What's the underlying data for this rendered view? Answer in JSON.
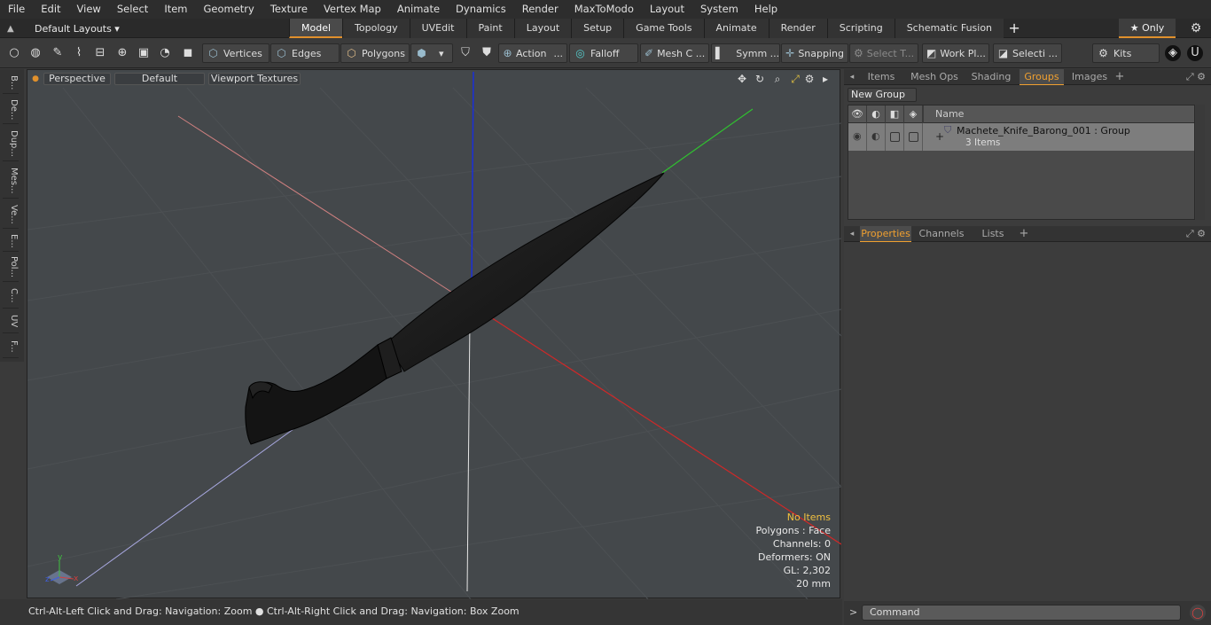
{
  "menu": [
    "File",
    "Edit",
    "View",
    "Select",
    "Item",
    "Geometry",
    "Texture",
    "Vertex Map",
    "Animate",
    "Dynamics",
    "Render",
    "MaxToModo",
    "Layout",
    "System",
    "Help"
  ],
  "tabbar": {
    "layout_label": "Default Layouts ▾",
    "tabs": [
      "Model",
      "Topology",
      "UVEdit",
      "Paint",
      "Layout",
      "Setup",
      "Game Tools",
      "Animate",
      "Render",
      "Scripting",
      "Schematic Fusion"
    ],
    "active_tab": "Model",
    "plus": "+",
    "only_label": "★  Only"
  },
  "toolbar": {
    "vertices": "Vertices",
    "edges": "Edges",
    "polygons": "Polygons",
    "action": "Action",
    "falloff": "Falloff",
    "mesh": "Mesh C ...",
    "symm": "Symm ...",
    "snapping": "Snapping",
    "select_t": "Select T...",
    "workplane": "Work Pl...",
    "selecti": "Selecti ...",
    "kits": "Kits"
  },
  "left_tabs": [
    "B...",
    "De...",
    "Dup...",
    "Mes...",
    "Ve...",
    "E...",
    "Pol...",
    "C...",
    "UV",
    "F..."
  ],
  "viewport": {
    "view_mode": "Perspective",
    "shading": "Default",
    "textures": "Viewport Textures",
    "info": {
      "items": "No Items",
      "polygons": "Polygons : Face",
      "channels": "Channels: 0",
      "deformers": "Deformers: ON",
      "gl": "GL: 2,302",
      "scale": "20 mm"
    },
    "colors": {
      "x_axis": "#c83030",
      "y_axis": "#30b030",
      "z_axis": "#2030c0",
      "model": "#1a1a1a"
    }
  },
  "status": "Ctrl-Alt-Left Click and Drag: Navigation: Zoom ● Ctrl-Alt-Right Click and Drag: Navigation: Box Zoom",
  "top_panel": {
    "tabs": [
      "Items",
      "Mesh Ops",
      "Shading",
      "Groups",
      "Images"
    ],
    "active": "Groups",
    "new_group": "New Group",
    "name_header": "Name",
    "row": {
      "title": "Machete_Knife_Barong_001 : Group",
      "subtitle": "3 Items"
    }
  },
  "bottom_panel": {
    "tabs": [
      "Properties",
      "Channels",
      "Lists"
    ],
    "active": "Properties"
  },
  "command": {
    "placeholder": "Command",
    "prompt": ">"
  }
}
